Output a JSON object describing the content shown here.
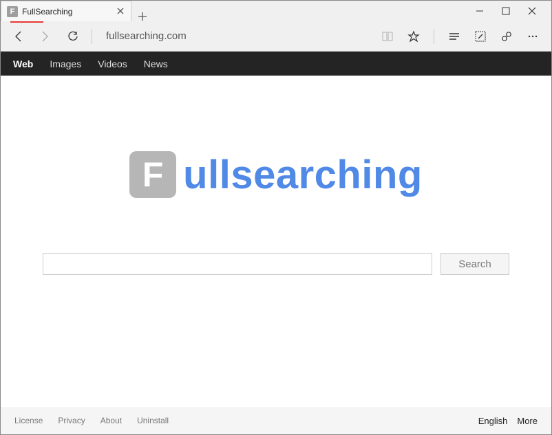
{
  "browser": {
    "tab_title": "FullSearching",
    "tab_favicon_letter": "F",
    "url": "fullsearching.com"
  },
  "nav": {
    "items": [
      {
        "label": "Web",
        "active": true
      },
      {
        "label": "Images",
        "active": false
      },
      {
        "label": "Videos",
        "active": false
      },
      {
        "label": "News",
        "active": false
      }
    ]
  },
  "logo": {
    "box_letter": "F",
    "rest_text": "ullsearching"
  },
  "search": {
    "value": "",
    "button_label": "Search"
  },
  "footer": {
    "left": [
      {
        "label": "License"
      },
      {
        "label": "Privacy"
      },
      {
        "label": "About"
      },
      {
        "label": "Uninstall"
      }
    ],
    "right": [
      {
        "label": "English"
      },
      {
        "label": "More"
      }
    ]
  }
}
